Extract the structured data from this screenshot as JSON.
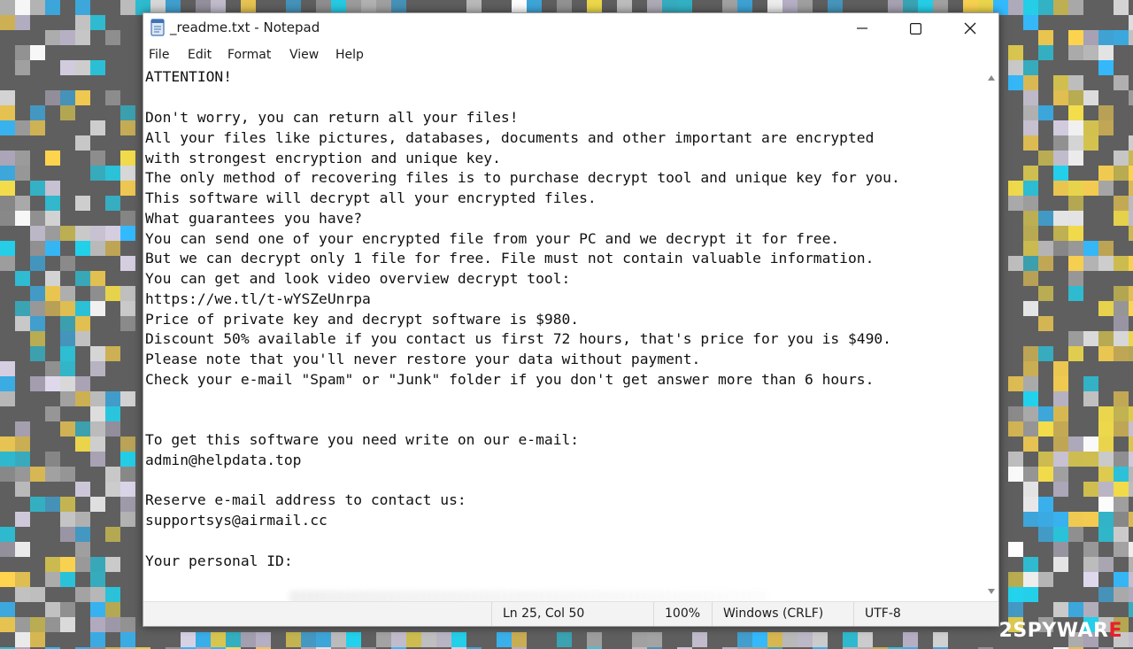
{
  "window": {
    "title": "_readme.txt - Notepad"
  },
  "menu": [
    "File",
    "Edit",
    "Format",
    "View",
    "Help"
  ],
  "document": {
    "lines": [
      "ATTENTION!",
      "",
      "Don't worry, you can return all your files!",
      "All your files like pictures, databases, documents and other important are encrypted",
      "with strongest encryption and unique key.",
      "The only method of recovering files is to purchase decrypt tool and unique key for you.",
      "This software will decrypt all your encrypted files.",
      "What guarantees you have?",
      "You can send one of your encrypted file from your PC and we decrypt it for free.",
      "But we can decrypt only 1 file for free. File must not contain valuable information.",
      "You can get and look video overview decrypt tool:",
      "https://we.tl/t-wYSZeUnrpa",
      "Price of private key and decrypt software is $980.",
      "Discount 50% available if you contact us first 72 hours, that's price for you is $490.",
      "Please note that you'll never restore your data without payment.",
      "Check your e-mail \"Spam\" or \"Junk\" folder if you don't get answer more than 6 hours.",
      "",
      "",
      "To get this software you need write on our e-mail:",
      "admin@helpdata.top",
      "",
      "Reserve e-mail address to contact us:",
      "supportsys@airmail.cc",
      "",
      "Your personal ID:"
    ]
  },
  "status": {
    "position": "Ln 25, Col 50",
    "zoom": "100%",
    "line_ending": "Windows (CRLF)",
    "encoding": "UTF-8"
  },
  "watermark": {
    "part1": "2SPYWAR",
    "part2": "E",
    "color1": "#ffffff",
    "color2": "#e8202a"
  },
  "colors": {
    "background": "#5f5f5f",
    "mosaic": [
      "#ffffff",
      "#d9d9d9",
      "#bcbcbc",
      "#b9b2c8",
      "#22d3ee",
      "#33bbff",
      "#f7e04a",
      "#ffd54f",
      "#e0d9ee",
      "#a4a4a4"
    ]
  }
}
